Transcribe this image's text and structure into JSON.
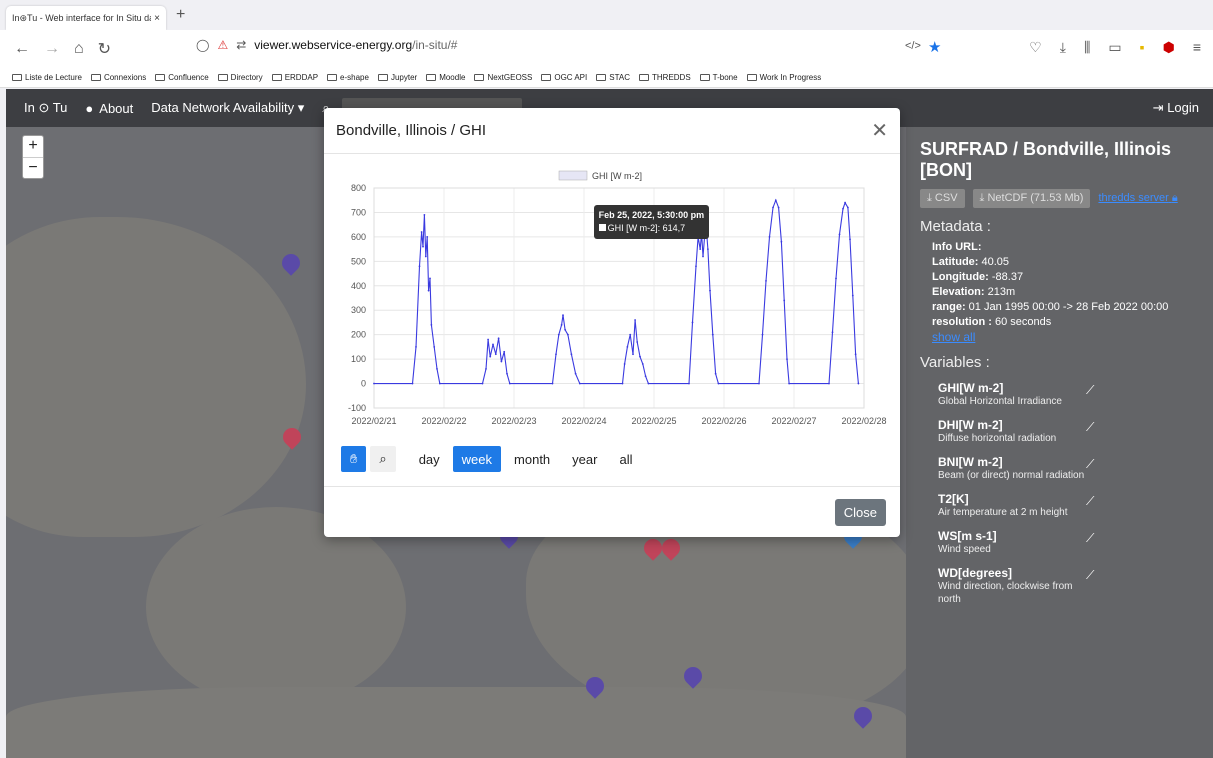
{
  "browser": {
    "tab_title": "In⊛Tu - Web interface for In Situ da",
    "tab_close": "×",
    "new_tab": "+",
    "url_host": "viewer.webservice-energy.org",
    "url_path": "/in-situ/#",
    "bookmarks": [
      "Liste de Lecture",
      "Connexions",
      "Confluence",
      "Directory",
      "ERDDAP",
      "e-shape",
      "Jupyter",
      "Moodle",
      "NextGEOSS",
      "OGC API",
      "STAC",
      "THREDDS",
      "T-bone",
      "Work In Progress"
    ]
  },
  "app": {
    "brand": "In ⊙ Tu",
    "about": "About",
    "data_network": "Data Network Availability ▾",
    "login": "Login"
  },
  "sidebar": {
    "title": "SURFRAD / Bondville, Illinois [BON]",
    "csv_button": "CSV",
    "netcdf_button": "NetCDF (71.53 Mb)",
    "thredds_link": "thredds server",
    "metadata_heading": "Metadata :",
    "metadata": [
      {
        "label": "Info URL:",
        "value": ""
      },
      {
        "label": "Latitude:",
        "value": "40.05"
      },
      {
        "label": "Longitude:",
        "value": "-88.37"
      },
      {
        "label": "Elevation:",
        "value": "213m"
      },
      {
        "label": "range:",
        "value": "01 Jan 1995 00:00 -> 28 Feb 2022 00:00"
      },
      {
        "label": "resolution :",
        "value": "60 seconds"
      }
    ],
    "show_all": "show all",
    "variables_heading": "Variables :",
    "variables": [
      {
        "name": "GHI[W m-2]",
        "desc": "Global Horizontal Irradiance"
      },
      {
        "name": "DHI[W m-2]",
        "desc": "Diffuse horizontal radiation"
      },
      {
        "name": "BNI[W m-2]",
        "desc": "Beam (or direct) normal radiation"
      },
      {
        "name": "T2[K]",
        "desc": "Air temperature at 2 m height"
      },
      {
        "name": "WS[m s-1]",
        "desc": "Wind speed"
      },
      {
        "name": "WD[degrees]",
        "desc": "Wind direction, clockwise from north"
      }
    ]
  },
  "modal": {
    "title": "Bondville, Illinois / GHI",
    "close_label": "Close",
    "range_buttons": [
      "day",
      "week",
      "month",
      "year",
      "all"
    ],
    "active_range": "week",
    "tooltip_time": "Feb 25, 2022, 5:30:00 pm",
    "tooltip_value": "GHI [W m-2]: 614,7"
  },
  "colors": {
    "series": "#3a3ae0",
    "accent": "#1e7ae6"
  },
  "chart_data": {
    "type": "line",
    "legend": [
      "GHI [W m-2]"
    ],
    "x_ticks": [
      "2022/02/21",
      "2022/02/22",
      "2022/02/23",
      "2022/02/24",
      "2022/02/25",
      "2022/02/26",
      "2022/02/27",
      "2022/02/28"
    ],
    "y_ticks": [
      -100,
      0,
      100,
      200,
      300,
      400,
      500,
      600,
      700,
      800
    ],
    "ylim": [
      -100,
      800
    ],
    "xlim_days": [
      0,
      7
    ],
    "series": [
      {
        "name": "GHI [W m-2]",
        "points": [
          [
            0.0,
            0
          ],
          [
            0.55,
            0
          ],
          [
            0.6,
            150
          ],
          [
            0.65,
            480
          ],
          [
            0.68,
            620
          ],
          [
            0.7,
            560
          ],
          [
            0.72,
            690
          ],
          [
            0.74,
            520
          ],
          [
            0.76,
            600
          ],
          [
            0.78,
            380
          ],
          [
            0.8,
            430
          ],
          [
            0.82,
            240
          ],
          [
            0.86,
            150
          ],
          [
            0.9,
            60
          ],
          [
            0.94,
            0
          ],
          [
            1.55,
            0
          ],
          [
            1.6,
            60
          ],
          [
            1.63,
            180
          ],
          [
            1.66,
            110
          ],
          [
            1.7,
            160
          ],
          [
            1.74,
            120
          ],
          [
            1.78,
            185
          ],
          [
            1.82,
            90
          ],
          [
            1.86,
            130
          ],
          [
            1.9,
            40
          ],
          [
            1.94,
            0
          ],
          [
            2.55,
            0
          ],
          [
            2.6,
            120
          ],
          [
            2.64,
            200
          ],
          [
            2.68,
            240
          ],
          [
            2.7,
            280
          ],
          [
            2.73,
            220
          ],
          [
            2.77,
            200
          ],
          [
            2.82,
            120
          ],
          [
            2.88,
            40
          ],
          [
            2.94,
            0
          ],
          [
            3.55,
            0
          ],
          [
            3.58,
            80
          ],
          [
            3.62,
            150
          ],
          [
            3.66,
            200
          ],
          [
            3.7,
            120
          ],
          [
            3.73,
            260
          ],
          [
            3.76,
            170
          ],
          [
            3.8,
            110
          ],
          [
            3.84,
            80
          ],
          [
            3.88,
            30
          ],
          [
            3.92,
            0
          ],
          [
            4.5,
            0
          ],
          [
            4.55,
            250
          ],
          [
            4.6,
            480
          ],
          [
            4.63,
            600
          ],
          [
            4.66,
            550
          ],
          [
            4.68,
            614.7
          ],
          [
            4.7,
            520
          ],
          [
            4.74,
            660
          ],
          [
            4.77,
            550
          ],
          [
            4.8,
            380
          ],
          [
            4.84,
            200
          ],
          [
            4.88,
            40
          ],
          [
            4.92,
            0
          ],
          [
            5.5,
            0
          ],
          [
            5.55,
            200
          ],
          [
            5.6,
            420
          ],
          [
            5.65,
            600
          ],
          [
            5.7,
            720
          ],
          [
            5.74,
            750
          ],
          [
            5.78,
            720
          ],
          [
            5.82,
            580
          ],
          [
            5.86,
            340
          ],
          [
            5.9,
            100
          ],
          [
            5.93,
            0
          ],
          [
            6.5,
            0
          ],
          [
            6.55,
            210
          ],
          [
            6.6,
            430
          ],
          [
            6.65,
            610
          ],
          [
            6.7,
            715
          ],
          [
            6.73,
            740
          ],
          [
            6.77,
            720
          ],
          [
            6.8,
            590
          ],
          [
            6.84,
            360
          ],
          [
            6.88,
            120
          ],
          [
            6.92,
            0
          ]
        ]
      }
    ],
    "grid": true,
    "legend_position": "top-center"
  }
}
